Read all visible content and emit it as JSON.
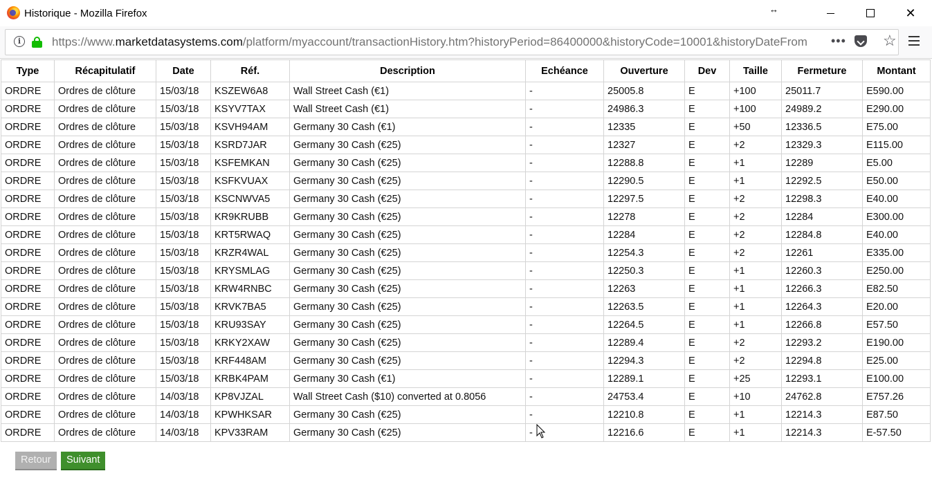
{
  "window": {
    "title": "Historique - Mozilla Firefox"
  },
  "browser": {
    "url_prefix": "https://www.",
    "url_host": "marketdatasystems.com",
    "url_path": "/platform/myaccount/transactionHistory.htm?historyPeriod=86400000&historyCode=10001&historyDateFrom",
    "page_actions": "•••"
  },
  "table": {
    "headers": [
      "Type",
      "Récapitulatif",
      "Date",
      "Réf.",
      "Description",
      "Echéance",
      "Ouverture",
      "Dev",
      "Taille",
      "Fermeture",
      "Montant"
    ],
    "rows": [
      [
        "ORDRE",
        "Ordres de clôture",
        "15/03/18",
        "KSZEW6A8",
        "Wall Street Cash (€1)",
        "-",
        "25005.8",
        "E",
        "+100",
        "25011.7",
        "E590.00"
      ],
      [
        "ORDRE",
        "Ordres de clôture",
        "15/03/18",
        "KSYV7TAX",
        "Wall Street Cash (€1)",
        "-",
        "24986.3",
        "E",
        "+100",
        "24989.2",
        "E290.00"
      ],
      [
        "ORDRE",
        "Ordres de clôture",
        "15/03/18",
        "KSVH94AM",
        "Germany 30 Cash (€1)",
        "-",
        "12335",
        "E",
        "+50",
        "12336.5",
        "E75.00"
      ],
      [
        "ORDRE",
        "Ordres de clôture",
        "15/03/18",
        "KSRD7JAR",
        "Germany 30 Cash (€25)",
        "-",
        "12327",
        "E",
        "+2",
        "12329.3",
        "E115.00"
      ],
      [
        "ORDRE",
        "Ordres de clôture",
        "15/03/18",
        "KSFEMKAN",
        "Germany 30 Cash (€25)",
        "-",
        "12288.8",
        "E",
        "+1",
        "12289",
        "E5.00"
      ],
      [
        "ORDRE",
        "Ordres de clôture",
        "15/03/18",
        "KSFKVUAX",
        "Germany 30 Cash (€25)",
        "-",
        "12290.5",
        "E",
        "+1",
        "12292.5",
        "E50.00"
      ],
      [
        "ORDRE",
        "Ordres de clôture",
        "15/03/18",
        "KSCNWVA5",
        "Germany 30 Cash (€25)",
        "-",
        "12297.5",
        "E",
        "+2",
        "12298.3",
        "E40.00"
      ],
      [
        "ORDRE",
        "Ordres de clôture",
        "15/03/18",
        "KR9KRUBB",
        "Germany 30 Cash (€25)",
        "-",
        "12278",
        "E",
        "+2",
        "12284",
        "E300.00"
      ],
      [
        "ORDRE",
        "Ordres de clôture",
        "15/03/18",
        "KRT5RWAQ",
        "Germany 30 Cash (€25)",
        "-",
        "12284",
        "E",
        "+2",
        "12284.8",
        "E40.00"
      ],
      [
        "ORDRE",
        "Ordres de clôture",
        "15/03/18",
        "KRZR4WAL",
        "Germany 30 Cash (€25)",
        "-",
        "12254.3",
        "E",
        "+2",
        "12261",
        "E335.00"
      ],
      [
        "ORDRE",
        "Ordres de clôture",
        "15/03/18",
        "KRYSMLAG",
        "Germany 30 Cash (€25)",
        "-",
        "12250.3",
        "E",
        "+1",
        "12260.3",
        "E250.00"
      ],
      [
        "ORDRE",
        "Ordres de clôture",
        "15/03/18",
        "KRW4RNBC",
        "Germany 30 Cash (€25)",
        "-",
        "12263",
        "E",
        "+1",
        "12266.3",
        "E82.50"
      ],
      [
        "ORDRE",
        "Ordres de clôture",
        "15/03/18",
        "KRVK7BA5",
        "Germany 30 Cash (€25)",
        "-",
        "12263.5",
        "E",
        "+1",
        "12264.3",
        "E20.00"
      ],
      [
        "ORDRE",
        "Ordres de clôture",
        "15/03/18",
        "KRU93SAY",
        "Germany 30 Cash (€25)",
        "-",
        "12264.5",
        "E",
        "+1",
        "12266.8",
        "E57.50"
      ],
      [
        "ORDRE",
        "Ordres de clôture",
        "15/03/18",
        "KRKY2XAW",
        "Germany 30 Cash (€25)",
        "-",
        "12289.4",
        "E",
        "+2",
        "12293.2",
        "E190.00"
      ],
      [
        "ORDRE",
        "Ordres de clôture",
        "15/03/18",
        "KRF448AM",
        "Germany 30 Cash (€25)",
        "-",
        "12294.3",
        "E",
        "+2",
        "12294.8",
        "E25.00"
      ],
      [
        "ORDRE",
        "Ordres de clôture",
        "15/03/18",
        "KRBK4PAM",
        "Germany 30 Cash (€1)",
        "-",
        "12289.1",
        "E",
        "+25",
        "12293.1",
        "E100.00"
      ],
      [
        "ORDRE",
        "Ordres de clôture",
        "14/03/18",
        "KP8VJZAL",
        "Wall Street Cash ($10) converted at 0.8056",
        "-",
        "24753.4",
        "E",
        "+10",
        "24762.8",
        "E757.26"
      ],
      [
        "ORDRE",
        "Ordres de clôture",
        "14/03/18",
        "KPWHKSAR",
        "Germany 30 Cash (€25)",
        "-",
        "12210.8",
        "E",
        "+1",
        "12214.3",
        "E87.50"
      ],
      [
        "ORDRE",
        "Ordres de clôture",
        "14/03/18",
        "KPV33RAM",
        "Germany 30 Cash (€25)",
        "-",
        "12216.6",
        "E",
        "+1",
        "12214.3",
        "E-57.50"
      ]
    ]
  },
  "pagination": {
    "prev_label": "Retour",
    "next_label": "Suivant"
  },
  "icons": {
    "app": "firefox-icon",
    "info": "info-icon",
    "lock": "lock-icon",
    "pocket": "pocket-icon",
    "bookmark": "star-icon",
    "menu": "hamburger-menu-icon"
  },
  "colors": {
    "lock_green": "#12bc00",
    "next_button": "#3f8f2c",
    "prev_button": "#b0b0b0",
    "grid_border": "#d4d4d4"
  }
}
